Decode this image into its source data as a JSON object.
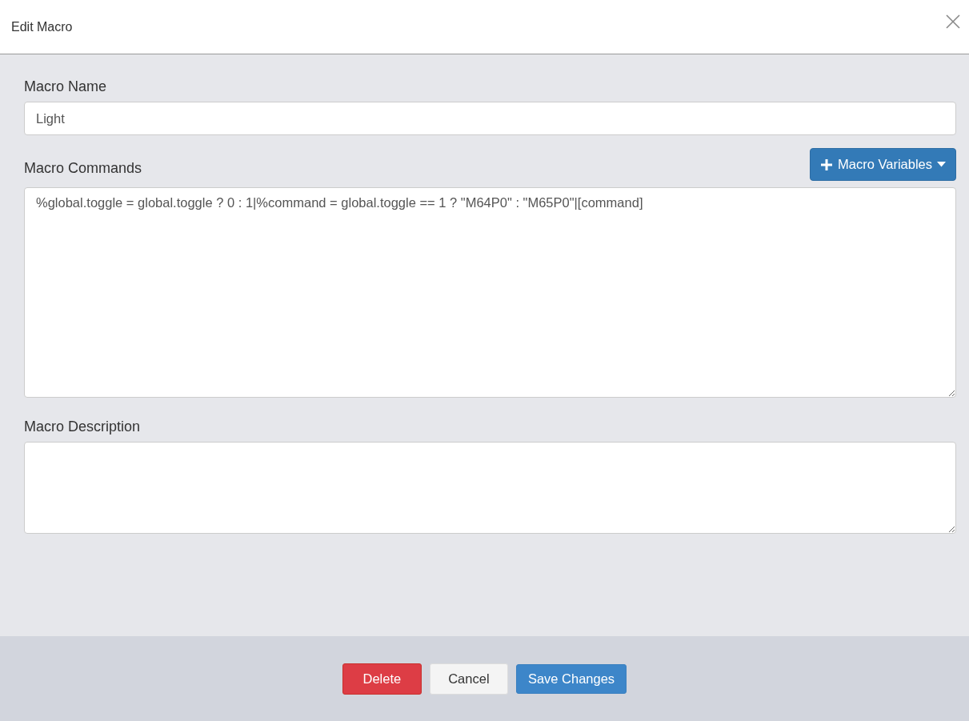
{
  "dialog": {
    "title": "Edit Macro"
  },
  "fields": [
    {
      "label": "Macro Name",
      "kind": "input",
      "value": "Light"
    },
    {
      "label": "Macro Commands",
      "kind": "textarea-large",
      "value": "%global.toggle = global.toggle ? 0 : 1|%command = global.toggle == 1 ? \"M64P0\" : \"M65P0\"|[command]",
      "action": "Macro Variables"
    },
    {
      "label": "Macro Description",
      "kind": "textarea-small"
    }
  ],
  "buttons": [
    {
      "label": "Delete",
      "kind": "danger"
    },
    {
      "label": "Cancel",
      "kind": "default"
    },
    {
      "label": "Save Changes",
      "kind": "primary"
    }
  ]
}
